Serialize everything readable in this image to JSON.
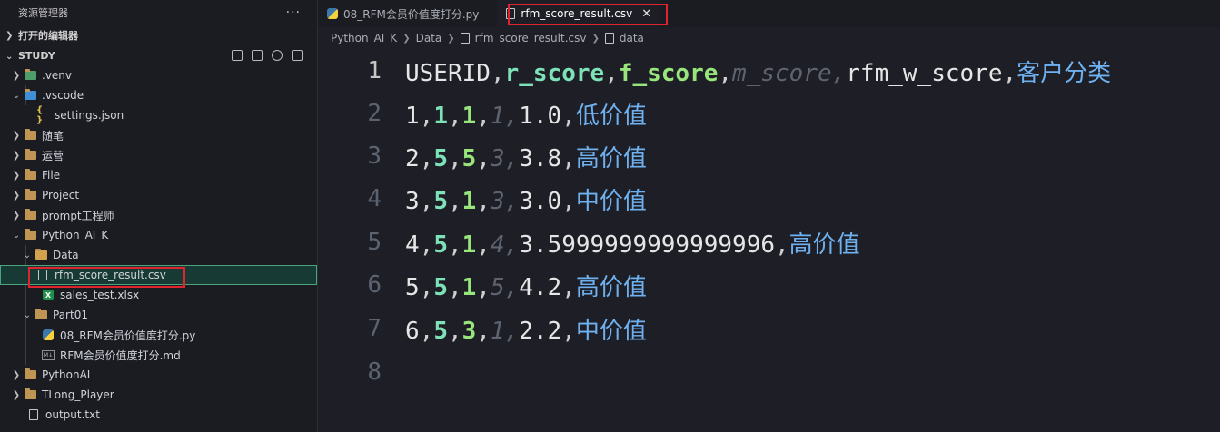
{
  "sidebar": {
    "title": "资源管理器",
    "more": "···",
    "open_editors": "打开的编辑器",
    "workspace": "STUDY",
    "items": [
      {
        "label": ".venv"
      },
      {
        "label": ".vscode"
      },
      {
        "label": "settings.json"
      },
      {
        "label": "随笔"
      },
      {
        "label": "运营"
      },
      {
        "label": "File"
      },
      {
        "label": "Project"
      },
      {
        "label": "prompt工程师"
      },
      {
        "label": "Python_AI_K"
      },
      {
        "label": "Data"
      },
      {
        "label": "rfm_score_result.csv"
      },
      {
        "label": "sales_test.xlsx"
      },
      {
        "label": "Part01"
      },
      {
        "label": "08_RFM会员价值度打分.py"
      },
      {
        "label": "RFM会员价值度打分.md"
      },
      {
        "label": "PythonAI"
      },
      {
        "label": "TLong_Player"
      },
      {
        "label": "output.txt"
      }
    ]
  },
  "tabs": [
    {
      "label": "08_RFM会员价值度打分.py"
    },
    {
      "label": "rfm_score_result.csv",
      "close": "✕"
    }
  ],
  "breadcrumb": [
    "Python_AI_K",
    "Data",
    "rfm_score_result.csv",
    "data"
  ],
  "editor": {
    "line_numbers": [
      "1",
      "2",
      "3",
      "4",
      "5",
      "6",
      "7",
      "8"
    ],
    "header": [
      "USERID",
      "r_score",
      "f_score",
      "m_score",
      "rfm_w_score",
      "客户分类"
    ],
    "rows": [
      [
        "1",
        "1",
        "1",
        "1",
        "1.0",
        "低价值"
      ],
      [
        "2",
        "5",
        "5",
        "3",
        "3.8",
        "高价值"
      ],
      [
        "3",
        "5",
        "1",
        "3",
        "3.0",
        "中价值"
      ],
      [
        "4",
        "5",
        "1",
        "4",
        "3.5999999999999996",
        "高价值"
      ],
      [
        "5",
        "5",
        "1",
        "5",
        "4.2",
        "高价值"
      ],
      [
        "6",
        "5",
        "3",
        "1",
        "2.2",
        "中价值"
      ]
    ]
  },
  "colors": {
    "accent_box": "#e0242f",
    "col1": "#e6e6e6",
    "col2": "#7ee2b8",
    "col3": "#98e57c",
    "col4": "#5e6370",
    "col6": "#6fb1f0"
  }
}
